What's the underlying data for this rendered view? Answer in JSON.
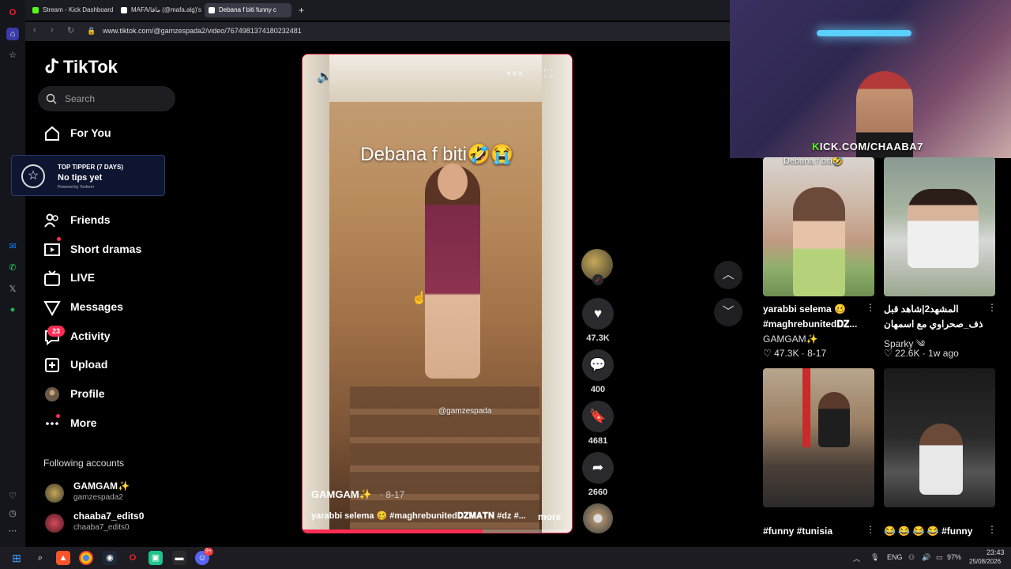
{
  "browser": {
    "tabs": [
      {
        "label": "Stream - Kick Dashboard",
        "color": "#53fc18"
      },
      {
        "label": "MAFA/مافا (@mafa.alg)'s",
        "color": "#ffffff"
      },
      {
        "label": "Debana f biti funny c",
        "color": "#ffffff"
      }
    ],
    "url": "www.tiktok.com/@gamzespada2/video/7674981374180232481"
  },
  "sidebar": {
    "logo": "TikTok",
    "search_placeholder": "Search",
    "nav": [
      {
        "label": "For You",
        "icon": "home-icon"
      },
      {
        "label": "Friends",
        "icon": "friends-icon"
      },
      {
        "label": "Short dramas",
        "icon": "short-dramas-icon"
      },
      {
        "label": "LIVE",
        "icon": "live-icon"
      },
      {
        "label": "Messages",
        "icon": "messages-icon"
      },
      {
        "label": "Activity",
        "icon": "activity-icon"
      },
      {
        "label": "Upload",
        "icon": "upload-icon"
      },
      {
        "label": "Profile",
        "icon": "profile-icon"
      },
      {
        "label": "More",
        "icon": "more-icon"
      }
    ],
    "activity_badge": "23",
    "following_title": "Following accounts",
    "following": [
      {
        "name": "GAMGAM✨",
        "handle": "gamzespada2"
      },
      {
        "name": "chaaba7_edits0",
        "handle": "chaaba7_edits0"
      }
    ]
  },
  "tip_widget": {
    "title": "TOP TIPPER (7 DAYS)",
    "main": "No tips yet",
    "powered": "Powered by Tonform"
  },
  "video": {
    "caption_overlay": "Debana f biti🤣😭",
    "watermark": "@gamzespada",
    "author": "GAMGAM✨",
    "date": "· 8-17",
    "description": "yarabbi selema 🥴 #maghrebunited𝐃𝐙𝐌𝐀𝐓𝐍 #dz #...",
    "more_link": "more",
    "progress": 0.67
  },
  "actions": {
    "likes": "47.3K",
    "comments": "400",
    "saves": "4681",
    "shares": "2660"
  },
  "webcam": {
    "kick_prefix": "K",
    "kick_rest": "ICK.COM/CHAABA7"
  },
  "related": [
    {
      "caption": "Debana f biti🤣",
      "title": "yarabbi selema 🥴",
      "subtitle": "#maghrebunited𝐃𝐙...",
      "author": "GAMGAM✨",
      "meta": "♡ 47.3K · 8-17"
    },
    {
      "title": "المشهد2|شاهد قبل",
      "subtitle": "الحذف_صحراوي مع اسمهان...",
      "author": "Sparky ༄",
      "meta": "♡ 22.6K · 1w ago"
    },
    {
      "title": "#funny #tunisia"
    },
    {
      "title": "😂 😂 😂 😂 #funny"
    }
  ],
  "taskbar": {
    "lang": "ENG",
    "battery": "97%",
    "time": "23:43",
    "date": "25/08/2026",
    "discord_badge": "9+"
  },
  "colors": {
    "accent": "#fe2c55",
    "kick_green": "#53fc18"
  }
}
